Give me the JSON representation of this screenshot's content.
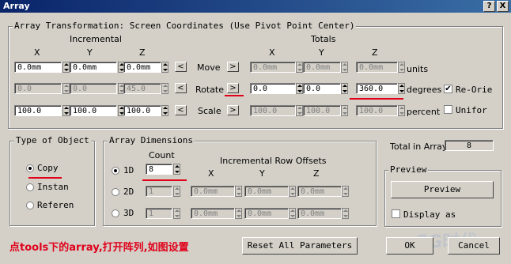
{
  "window": {
    "title": "Array",
    "help_btn": "?",
    "close_btn": "X"
  },
  "transform": {
    "group_label": "Array Transformation: Screen Coordinates (Use Pivot Point Center)",
    "incremental_label": "Incremental",
    "totals_label": "Totals",
    "axes": [
      "X",
      "Y",
      "Z"
    ],
    "rows": [
      {
        "label": "Move",
        "inc": [
          "0.0mm",
          "0.0mm",
          "0.0mm"
        ],
        "tot": [
          "0.0mm",
          "0.0mm",
          "0.0mm"
        ],
        "unit": "units",
        "left_arrow": "<",
        "right_arrow": ">"
      },
      {
        "label": "Rotate",
        "inc": [
          "0.0",
          "0.0",
          "45.0"
        ],
        "tot": [
          "0.0",
          "0.0",
          "360.0"
        ],
        "unit": "degrees",
        "left_arrow": "<",
        "right_arrow": ">"
      },
      {
        "label": "Scale",
        "inc": [
          "100.0",
          "100.0",
          "100.0"
        ],
        "tot": [
          "100.0",
          "100.0",
          "100.0"
        ],
        "unit": "percent",
        "left_arrow": "<",
        "right_arrow": ">"
      }
    ],
    "reorient_label": "Re-Orie",
    "reorient_checked": true,
    "uniform_label": "Unifor",
    "uniform_checked": false
  },
  "type_of_object": {
    "group_label": "Type of Object",
    "options": [
      "Copy",
      "Instan",
      "Referen"
    ],
    "selected": 0
  },
  "dimensions": {
    "group_label": "Array Dimensions",
    "count_label": "Count",
    "row_offsets_label": "Incremental Row Offsets",
    "axes": [
      "X",
      "Y",
      "Z"
    ],
    "rows": [
      {
        "label": "1D",
        "count": "8",
        "offsets": []
      },
      {
        "label": "2D",
        "count": "1",
        "offsets": [
          "0.0mm",
          "0.0mm",
          "0.0mm"
        ]
      },
      {
        "label": "3D",
        "count": "1",
        "offsets": [
          "0.0mm",
          "0.0mm",
          "0.0mm"
        ]
      }
    ],
    "selected": 0
  },
  "total": {
    "label": "Total in Array:",
    "value": "8"
  },
  "preview": {
    "group_label": "Preview",
    "button": "Preview",
    "display_label": "Display as",
    "display_checked": false
  },
  "buttons": {
    "reset": "Reset All Parameters",
    "ok": "OK",
    "cancel": "Cancel"
  },
  "annotation": "点tools下的array,打开阵列,如图设置",
  "watermark": "CG时代",
  "colors": {
    "title_bar": "#0a246a",
    "annotation_red": "#e0001a",
    "dialog_bg": "#d4d0c8"
  }
}
